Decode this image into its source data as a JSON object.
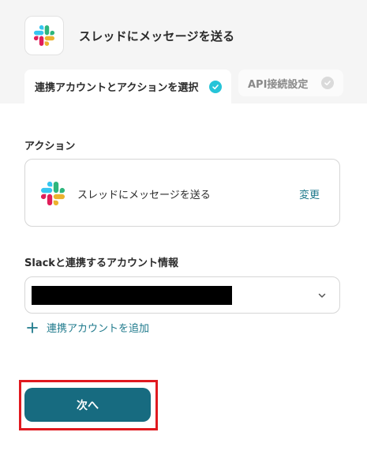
{
  "header": {
    "app_title": "スレッドにメッセージを送る",
    "app_icon": "slack-logo"
  },
  "tabs": [
    {
      "label": "連携アカウントとアクションを選択",
      "state": "active",
      "icon": "check-circle-icon"
    },
    {
      "label": "API接続設定",
      "state": "inactive",
      "icon": "check-circle-icon"
    }
  ],
  "action_section": {
    "label": "アクション",
    "action_name": "スレッドにメッセージを送る",
    "change_label": "変更"
  },
  "account_section": {
    "label": "Slackと連携するアカウント情報",
    "add_account_label": "連携アカウントを追加"
  },
  "footer": {
    "next_label": "次へ"
  },
  "colors": {
    "accent_teal": "#176b80",
    "link_teal": "#1f7a8c",
    "check_cyan": "#26c4d8",
    "highlight_red": "#e0191f"
  }
}
